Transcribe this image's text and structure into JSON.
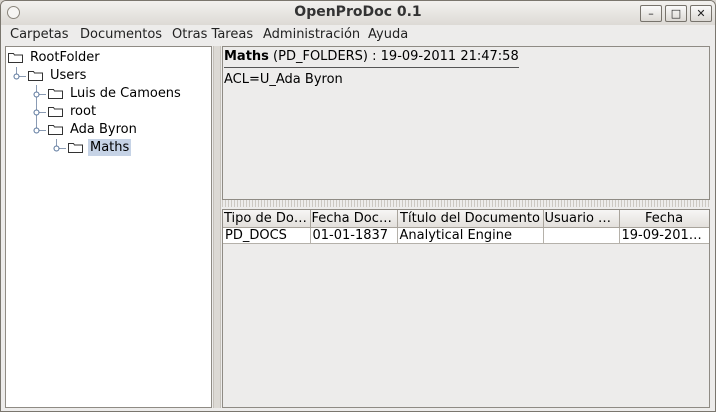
{
  "window": {
    "title": "OpenProDoc 0.1"
  },
  "menu": [
    "Carpetas",
    "Documentos",
    "Otras Tareas",
    "Administración",
    "Ayuda"
  ],
  "tree": [
    {
      "label": "RootFolder",
      "depth": 0,
      "selected": false
    },
    {
      "label": "Users",
      "depth": 1,
      "selected": false
    },
    {
      "label": "Luis de Camoens",
      "depth": 2,
      "selected": false
    },
    {
      "label": "root",
      "depth": 2,
      "selected": false
    },
    {
      "label": "Ada Byron",
      "depth": 2,
      "selected": false
    },
    {
      "label": "Maths",
      "depth": 3,
      "selected": true
    }
  ],
  "folder_info": {
    "name": "Maths",
    "detail": " (PD_FOLDERS) : 19-09-2011 21:47:58",
    "acl": "ACL=U_Ada Byron"
  },
  "documents": {
    "headers": [
      "Tipo de Doc...",
      "Fecha Docu...",
      "Título del Documento",
      "Usuario d...",
      "Fecha"
    ],
    "rows": [
      [
        "PD_DOCS",
        "01-01-1837",
        "Analytical Engine",
        "",
        "19-09-2011..."
      ]
    ]
  }
}
